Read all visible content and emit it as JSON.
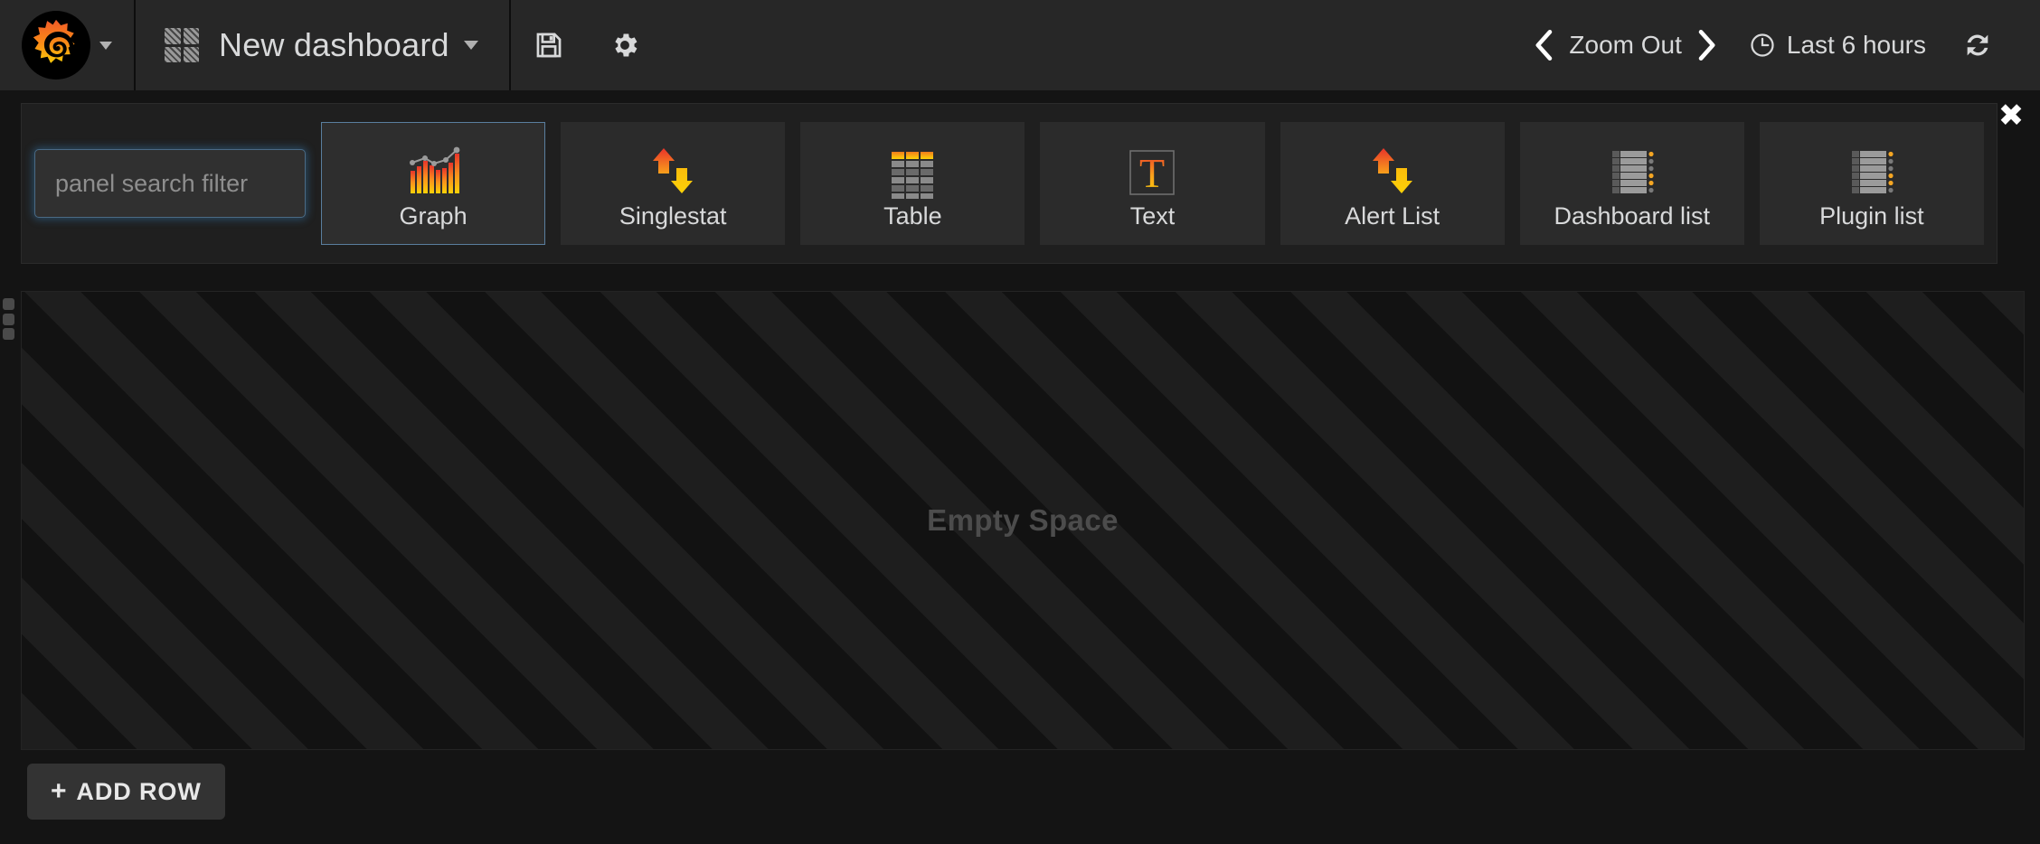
{
  "navbar": {
    "logo_icon": "grafana-logo-icon",
    "logo_caret_icon": "chevron-down-icon",
    "dashboard_grid_icon": "dashboard-grid-icon",
    "title": "New dashboard",
    "title_caret_icon": "chevron-down-icon",
    "save_icon": "save-floppy-icon",
    "settings_icon": "gear-icon",
    "zoom_back_icon": "chevron-left-icon",
    "zoom_out_label": "Zoom Out",
    "zoom_forward_icon": "chevron-right-icon",
    "time_clock_icon": "clock-icon",
    "time_range": "Last 6 hours",
    "refresh_icon": "refresh-icon"
  },
  "panel_picker": {
    "search": {
      "placeholder": "panel search filter",
      "value": ""
    },
    "close_label": "✖",
    "tiles": [
      {
        "label": "Graph",
        "icon": "graph-panel-icon",
        "selected": true
      },
      {
        "label": "Singlestat",
        "icon": "singlestat-panel-icon",
        "selected": false
      },
      {
        "label": "Table",
        "icon": "table-panel-icon",
        "selected": false
      },
      {
        "label": "Text",
        "icon": "text-panel-icon",
        "selected": false
      },
      {
        "label": "Alert List",
        "icon": "alertlist-panel-icon",
        "selected": false
      },
      {
        "label": "Dashboard list",
        "icon": "dashboardlist-panel-icon",
        "selected": false
      },
      {
        "label": "Plugin list",
        "icon": "pluginlist-panel-icon",
        "selected": false
      }
    ]
  },
  "dashboard": {
    "row_handle_icon": "drag-handle-icon",
    "empty_space_label": "Empty Space",
    "add_row_label": "ADD ROW",
    "add_row_plus": "+"
  },
  "colors": {
    "navbar_bg": "#272727",
    "page_bg": "#141414",
    "panel_bg": "#1f1f1f",
    "tile_bg": "#2b2b2b",
    "accent_blue": "#5a7e9e",
    "text_primary": "#d8d9da",
    "brand_orange": "#f05a28",
    "brand_yellow": "#fbca0a"
  }
}
